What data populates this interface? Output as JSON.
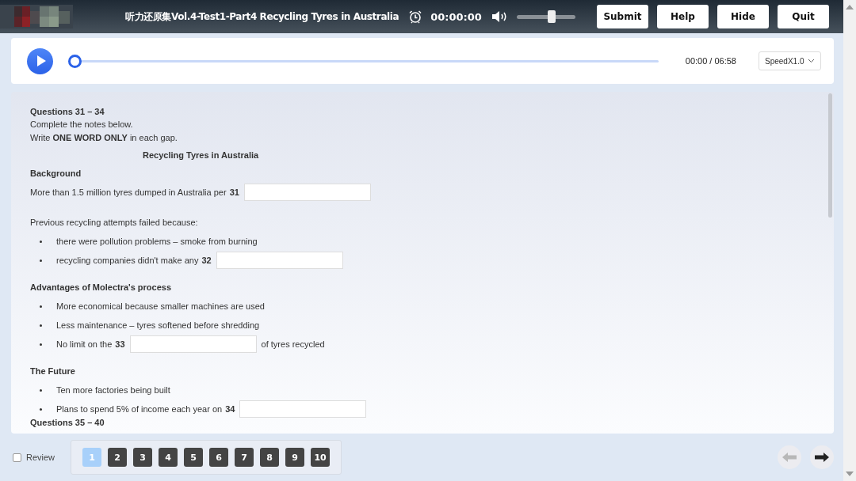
{
  "header": {
    "title": "听力还原集Vol.4-Test1-Part4 Recycling Tyres in Australia",
    "timer": "00:00:00",
    "volume": {
      "level": 0.6
    },
    "buttons": [
      "Submit",
      "Help",
      "Hide",
      "Quit"
    ]
  },
  "player": {
    "progress": {
      "level": 0
    },
    "time": "00:00 / 06:58",
    "speed": "SpeedX1.0"
  },
  "questions": {
    "heading": "Questions 31 – 34",
    "instructions": [
      "Complete the notes below.",
      "Write **ONE WORD ONLY** in each gap."
    ],
    "notes_title": "Recycling Tyres in Australia",
    "sections": [
      {
        "heading": "Background",
        "groups": [
          {
            "items": [
              {
                "kind": "line",
                "text": "More than 1.5 million tyres dumped in Australia per",
                "number": "31"
              }
            ]
          },
          {
            "items": [
              {
                "kind": "line",
                "text": "Previous recycling attempts failed because:"
              },
              {
                "kind": "bullet",
                "text": "there were pollution problems – smoke from burning"
              },
              {
                "kind": "bullet",
                "text": "recycling companies didn't make any",
                "number": "32"
              }
            ]
          }
        ]
      },
      {
        "heading": "Advantages of Molectra's process",
        "groups": [
          {
            "items": [
              {
                "kind": "bullet",
                "text": "More economical because smaller machines are used"
              },
              {
                "kind": "bullet",
                "text": "Less maintenance – tyres softened before shredding"
              },
              {
                "kind": "bullet",
                "text": "No limit on the",
                "number": "33",
                "after": "of tyres recycled"
              }
            ]
          }
        ]
      },
      {
        "heading": "The Future",
        "groups": [
          {
            "items": [
              {
                "kind": "bullet",
                "text": "Ten more factories being built"
              },
              {
                "kind": "bullet",
                "text": "Plans to spend 5% of income each year on",
                "number": "34"
              }
            ]
          }
        ]
      }
    ],
    "next_heading": "Questions 35 – 40"
  },
  "footer": {
    "review": {
      "label": "Review",
      "checked": false
    },
    "pages": [
      {
        "label": "1",
        "selected": true
      },
      {
        "label": "2",
        "selected": false
      },
      {
        "label": "3",
        "selected": false
      },
      {
        "label": "4",
        "selected": false
      },
      {
        "label": "5",
        "selected": false
      },
      {
        "label": "6",
        "selected": false
      },
      {
        "label": "7",
        "selected": false
      },
      {
        "label": "8",
        "selected": false
      },
      {
        "label": "9",
        "selected": false
      },
      {
        "label": "10",
        "selected": false
      }
    ],
    "prev": {
      "disabled": true
    },
    "next": {
      "disabled": false
    }
  }
}
